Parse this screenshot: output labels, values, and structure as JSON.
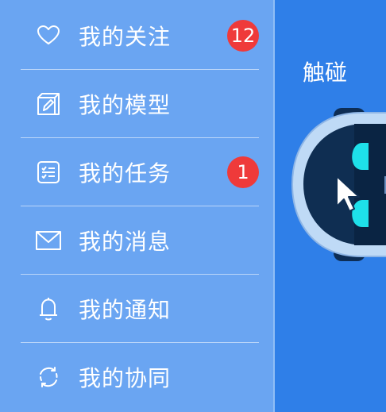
{
  "menu": {
    "items": [
      {
        "label": "我的关注",
        "icon": "heart-icon",
        "badge": "12"
      },
      {
        "label": "我的模型",
        "icon": "model-edit-icon",
        "badge": ""
      },
      {
        "label": "我的任务",
        "icon": "task-list-icon",
        "badge": "1"
      },
      {
        "label": "我的消息",
        "icon": "mail-icon",
        "badge": ""
      },
      {
        "label": "我的通知",
        "icon": "bell-icon",
        "badge": ""
      },
      {
        "label": "我的协同",
        "icon": "collaboration-icon",
        "badge": ""
      }
    ]
  },
  "touch_area": {
    "label": "触碰",
    "icon": "mascot-pointer-icon"
  },
  "colors": {
    "background": "#2f7fe8",
    "menu_panel": "#6aa5f2",
    "badge": "#ef3a3a",
    "text": "#ffffff"
  }
}
